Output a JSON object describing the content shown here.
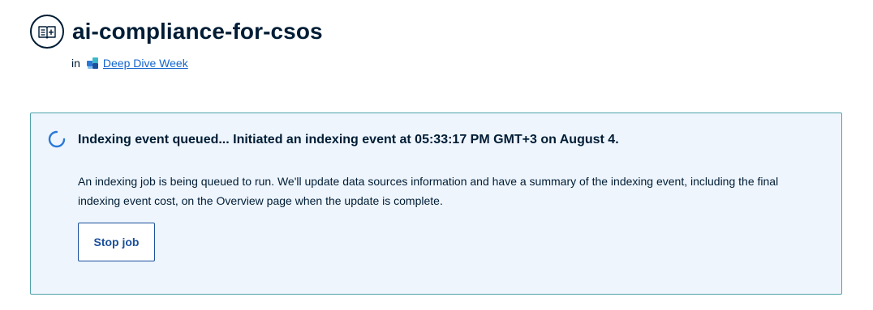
{
  "header": {
    "title": "ai-compliance-for-csos",
    "icon": "knowledge-base-icon",
    "in_label": "in",
    "space_icon": "space-icon",
    "space_name": "Deep Dive Week"
  },
  "banner": {
    "status_icon": "loading-spinner-icon",
    "title": "Indexing event queued... Initiated an indexing event at 05:33:17 PM GMT+3 on August 4.",
    "body": "An indexing job is being queued to run. We'll update data sources information and have a summary of the indexing event, including the final indexing event cost, on the Overview page when the update is complete.",
    "stop_label": "Stop job"
  },
  "colors": {
    "text": "#001d35",
    "link": "#1466cc",
    "banner_bg": "#eef5fd",
    "banner_border": "#4fa3a8",
    "button": "#1a4f9c",
    "spinner": "#2a78d8"
  }
}
